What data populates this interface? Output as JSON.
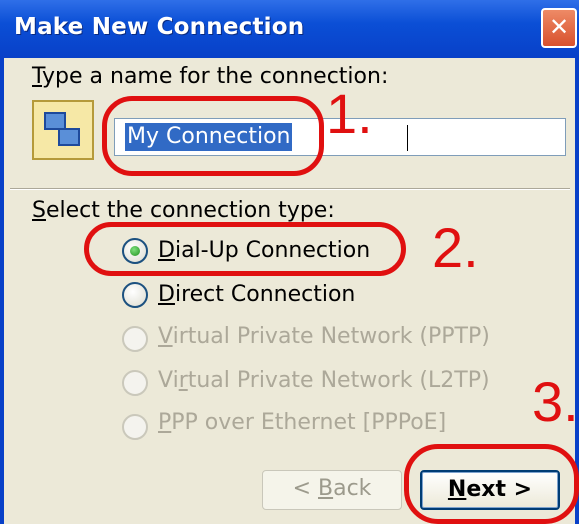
{
  "window": {
    "title": "Make New Connection",
    "close_label": "✕"
  },
  "name_section": {
    "prompt_pre": "",
    "prompt_accel": "T",
    "prompt_post": "ype a name for the connection:",
    "value": "My Connection",
    "icon": "network-connection-icon"
  },
  "type_section": {
    "prompt_pre": "",
    "prompt_accel": "S",
    "prompt_post": "elect the connection type:",
    "options": [
      {
        "pre": "",
        "accel": "D",
        "post": "ial-Up Connection",
        "checked": true,
        "enabled": true
      },
      {
        "pre": "",
        "accel": "D",
        "post": "irect Connection",
        "checked": false,
        "enabled": true
      },
      {
        "pre": "",
        "accel": "V",
        "post": "irtual Private Network (PPTP)",
        "checked": false,
        "enabled": false
      },
      {
        "pre": "Vi",
        "accel": "r",
        "post": "tual Private Network (L2TP)",
        "checked": false,
        "enabled": false
      },
      {
        "pre": "",
        "accel": "P",
        "post": "PP over Ethernet [PPPoE]",
        "checked": false,
        "enabled": false
      }
    ]
  },
  "buttons": {
    "back_pre": "< ",
    "back_accel": "B",
    "back_post": "ack",
    "next_pre": "",
    "next_accel": "N",
    "next_post": "ext >"
  },
  "annotations": {
    "one": "1.",
    "two": "2.",
    "three": "3."
  },
  "colors": {
    "titlebar": "#0840c8",
    "annotation": "#e01010",
    "dialog_bg": "#ece9d8"
  }
}
